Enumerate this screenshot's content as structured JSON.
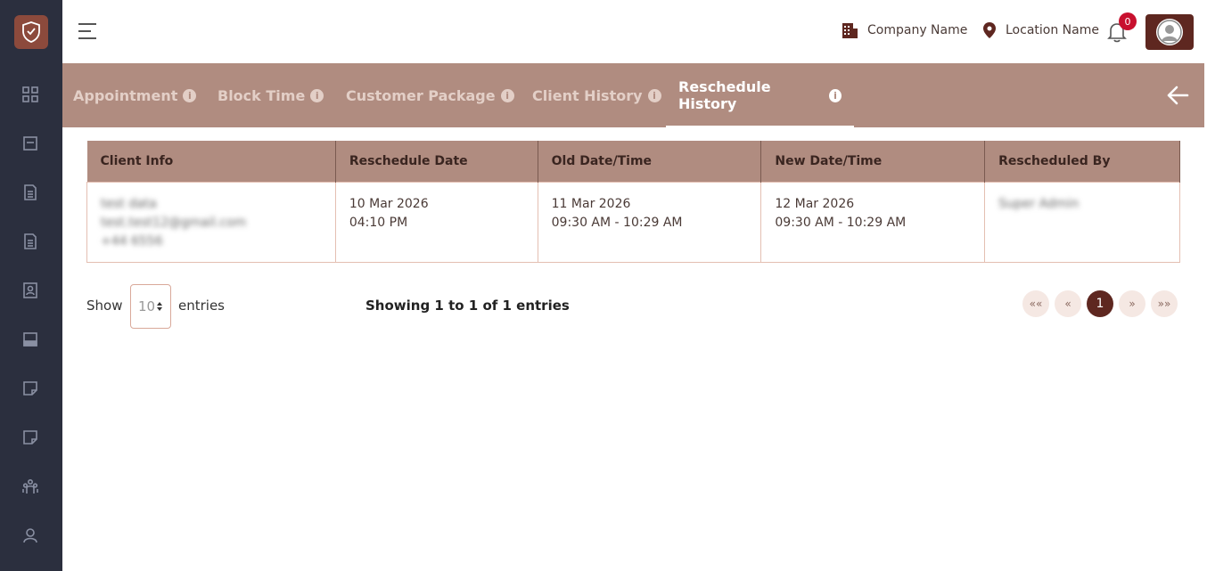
{
  "header": {
    "company": "Company Name",
    "location": "Location Name",
    "notification_count": "0"
  },
  "tabs": [
    {
      "label": "Appointment"
    },
    {
      "label": "Block Time"
    },
    {
      "label": "Customer Package"
    },
    {
      "label": "Client History"
    },
    {
      "label": "Reschedule History"
    }
  ],
  "active_tab": "Reschedule History",
  "table": {
    "columns": [
      "Client Info",
      "Reschedule Date",
      "Old Date/Time",
      "New Date/Time",
      "Rescheduled By"
    ],
    "rows": [
      {
        "client_name": "test data",
        "client_email": "test.test12@gmail.com",
        "client_phone": "+44 6556",
        "reschedule_date": "10 Mar 2026",
        "reschedule_time": "04:10 PM",
        "old_date": "11 Mar 2026",
        "old_time": "09:30 AM - 10:29 AM",
        "new_date": "12 Mar 2026",
        "new_time": "09:30 AM - 10:29 AM",
        "rescheduled_by": "Super Admin"
      }
    ]
  },
  "footer": {
    "show_label": "Show",
    "page_size": "10",
    "entries_label": "entries",
    "showing_text": "Showing 1 to 1 of 1 entries"
  },
  "pagination": {
    "first": "««",
    "prev": "«",
    "current": "1",
    "next": "»",
    "last": "»»"
  },
  "colors": {
    "sidebar": "#2b2f3e",
    "tabbar": "#b08c80",
    "accent": "#5e2720",
    "badge": "#c8102e"
  }
}
